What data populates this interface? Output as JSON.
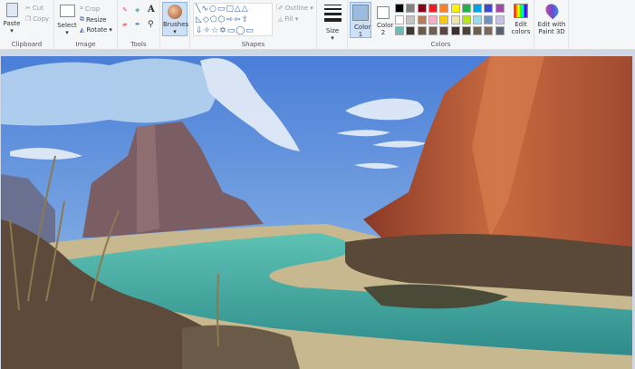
{
  "clipboard": {
    "paste": "Paste",
    "cut": "Cut",
    "copy": "Copy",
    "label": "Clipboard"
  },
  "image": {
    "select": "Select",
    "crop": "Crop",
    "resize": "Resize",
    "rotate": "Rotate",
    "label": "Image"
  },
  "tools": {
    "label": "Tools"
  },
  "brushes": {
    "label": "Brushes"
  },
  "shapes": {
    "label": "Shapes",
    "outline": "Outline",
    "fill": "Fill"
  },
  "size": {
    "label": "Size"
  },
  "colors": {
    "color1": "Color 1",
    "color2": "Color 2",
    "edit": "Edit colors",
    "label": "Colors",
    "color1_value": "#99bce0",
    "color2_value": "#ffffff",
    "palette": [
      "#000000",
      "#7f7f7f",
      "#880015",
      "#ed1c24",
      "#ff7f27",
      "#fff200",
      "#22b14c",
      "#00a2e8",
      "#3f48cc",
      "#a349a4",
      "#ffffff",
      "#c3c3c3",
      "#b97a57",
      "#ffaec9",
      "#ffc90e",
      "#efe4b0",
      "#b5e61d",
      "#99d9ea",
      "#7092be",
      "#c8bfe7",
      "#6bbdb5",
      "#3e3630",
      "#6b5a45",
      "#6e6050",
      "#5a4540",
      "#3a3030",
      "#4a4438",
      "#6e5e4c",
      "#7b6b5c",
      "#5a6070"
    ]
  },
  "paint3d": {
    "label": "Edit with Paint 3D"
  }
}
